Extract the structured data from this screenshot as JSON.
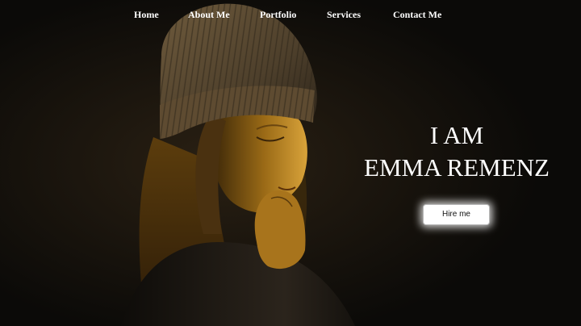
{
  "nav": {
    "items": [
      {
        "label": "Home"
      },
      {
        "label": "About Me"
      },
      {
        "label": "Portfolio"
      },
      {
        "label": "Services"
      },
      {
        "label": "Contact Me"
      }
    ]
  },
  "hero": {
    "line1": "I AM",
    "line2": "EMMA REMENZ",
    "button_label": "Hire me"
  },
  "colors": {
    "background": "#0c0b09",
    "tint": "#c18a1f",
    "text": "#ffffff"
  }
}
